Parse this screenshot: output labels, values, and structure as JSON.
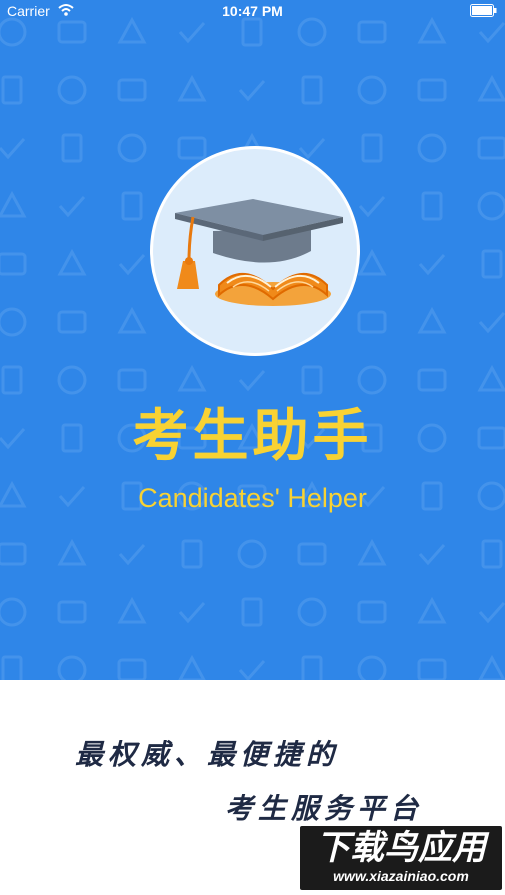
{
  "statusbar": {
    "carrier": "Carrier",
    "time": "10:47 PM"
  },
  "splash": {
    "title_cn": "考生助手",
    "title_en": "Candidates' Helper",
    "logo_icon": "graduation-cap-book-icon",
    "accent_color": "#2f86e8",
    "title_color": "#f8d233"
  },
  "tagline": {
    "line1": "最权威、最便捷的",
    "line2": "考生服务平台"
  },
  "watermark": {
    "text": "下载鸟应用",
    "url": "www.xiazainiao.com"
  }
}
